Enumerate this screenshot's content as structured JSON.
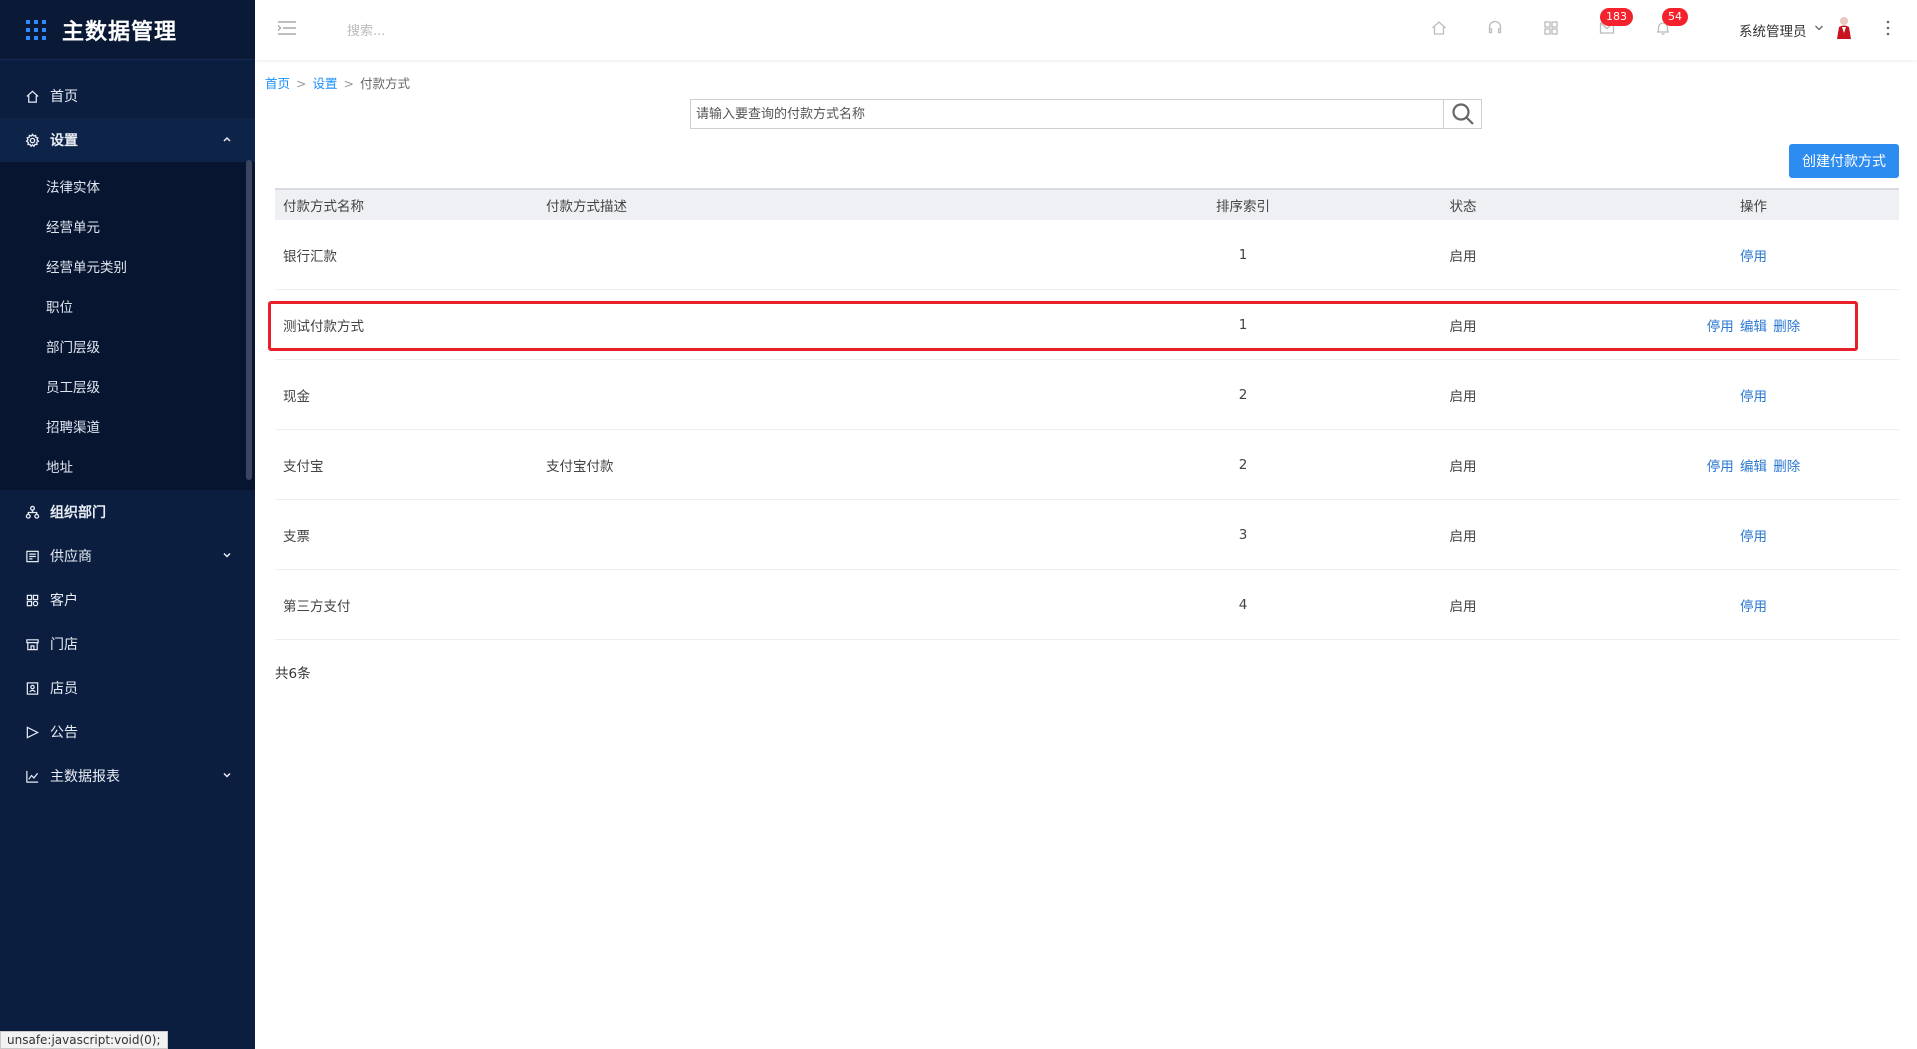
{
  "app": {
    "title": "主数据管理"
  },
  "sidebar": {
    "items": [
      {
        "label": "首页",
        "icon": "home-icon"
      },
      {
        "label": "设置",
        "icon": "gear-icon",
        "expanded": true,
        "children": [
          "法律实体",
          "经营单元",
          "经营单元类别",
          "职位",
          "部门层级",
          "员工层级",
          "招聘渠道",
          "地址"
        ]
      },
      {
        "label": "组织部门",
        "icon": "org-icon"
      },
      {
        "label": "供应商",
        "icon": "supplier-icon",
        "has_children": true
      },
      {
        "label": "客户",
        "icon": "customer-icon"
      },
      {
        "label": "门店",
        "icon": "store-icon"
      },
      {
        "label": "店员",
        "icon": "clerk-icon"
      },
      {
        "label": "公告",
        "icon": "announcement-icon"
      },
      {
        "label": "主数据报表",
        "icon": "chart-icon",
        "has_children": true
      }
    ]
  },
  "statusbar": {
    "text": "unsafe:javascript:void(0);"
  },
  "topbar": {
    "search_placeholder": "搜索...",
    "messages_badge": "183",
    "notifications_badge": "54",
    "user_name": "系统管理员"
  },
  "breadcrumb": {
    "home": "首页",
    "settings": "设置",
    "current": "付款方式",
    "sep": ">"
  },
  "search": {
    "placeholder": "请输入要查询的付款方式名称",
    "value": ""
  },
  "create_button": "创建付款方式",
  "table": {
    "headers": [
      "付款方式名称",
      "付款方式描述",
      "排序索引",
      "状态",
      "操作"
    ],
    "rows": [
      {
        "name": "银行汇款",
        "desc": "",
        "index": "1",
        "status": "启用",
        "actions": [
          "停用"
        ]
      },
      {
        "name": "测试付款方式",
        "desc": "",
        "index": "1",
        "status": "启用",
        "actions": [
          "停用",
          "编辑",
          "删除"
        ],
        "highlighted": true
      },
      {
        "name": "现金",
        "desc": "",
        "index": "2",
        "status": "启用",
        "actions": [
          "停用"
        ]
      },
      {
        "name": "支付宝",
        "desc": "支付宝付款",
        "index": "2",
        "status": "启用",
        "actions": [
          "停用",
          "编辑",
          "删除"
        ]
      },
      {
        "name": "支票",
        "desc": "",
        "index": "3",
        "status": "启用",
        "actions": [
          "停用"
        ]
      },
      {
        "name": "第三方支付",
        "desc": "",
        "index": "4",
        "status": "启用",
        "actions": [
          "停用"
        ]
      }
    ],
    "total": "共6条"
  },
  "colors": {
    "sidebar_bg": "#0b1e3f",
    "accent": "#2d8cf0",
    "link": "#2b78d0",
    "badge": "#f5222d",
    "highlight": "#e8202a"
  }
}
